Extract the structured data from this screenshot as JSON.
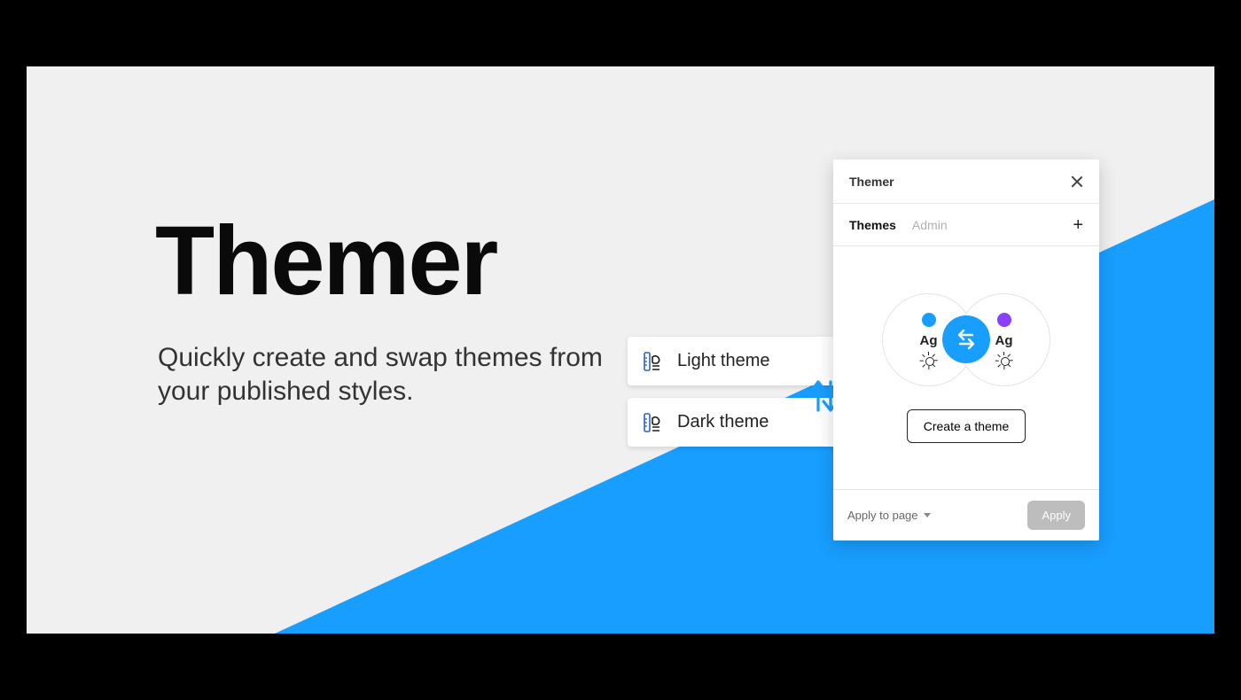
{
  "hero": {
    "title": "Themer",
    "subtitle": "Quickly create and swap themes from your published styles."
  },
  "chips": {
    "light": "Light theme",
    "dark": "Dark theme",
    "icon": "ruler-palette-icon"
  },
  "panel": {
    "title": "Themer",
    "tabs": {
      "themes": "Themes",
      "admin": "Admin"
    },
    "swatches": {
      "left": {
        "dot_color": "#189eff",
        "ag": "Ag"
      },
      "right": {
        "dot_color": "#8a3ffc",
        "ag": "Ag"
      }
    },
    "create_label": "Create a theme",
    "footer": {
      "scope_label": "Apply to page",
      "apply_label": "Apply"
    }
  },
  "colors": {
    "accent": "#189eff",
    "bg": "#f0f0f0",
    "text": "#222222",
    "muted": "#b0b0b0"
  }
}
